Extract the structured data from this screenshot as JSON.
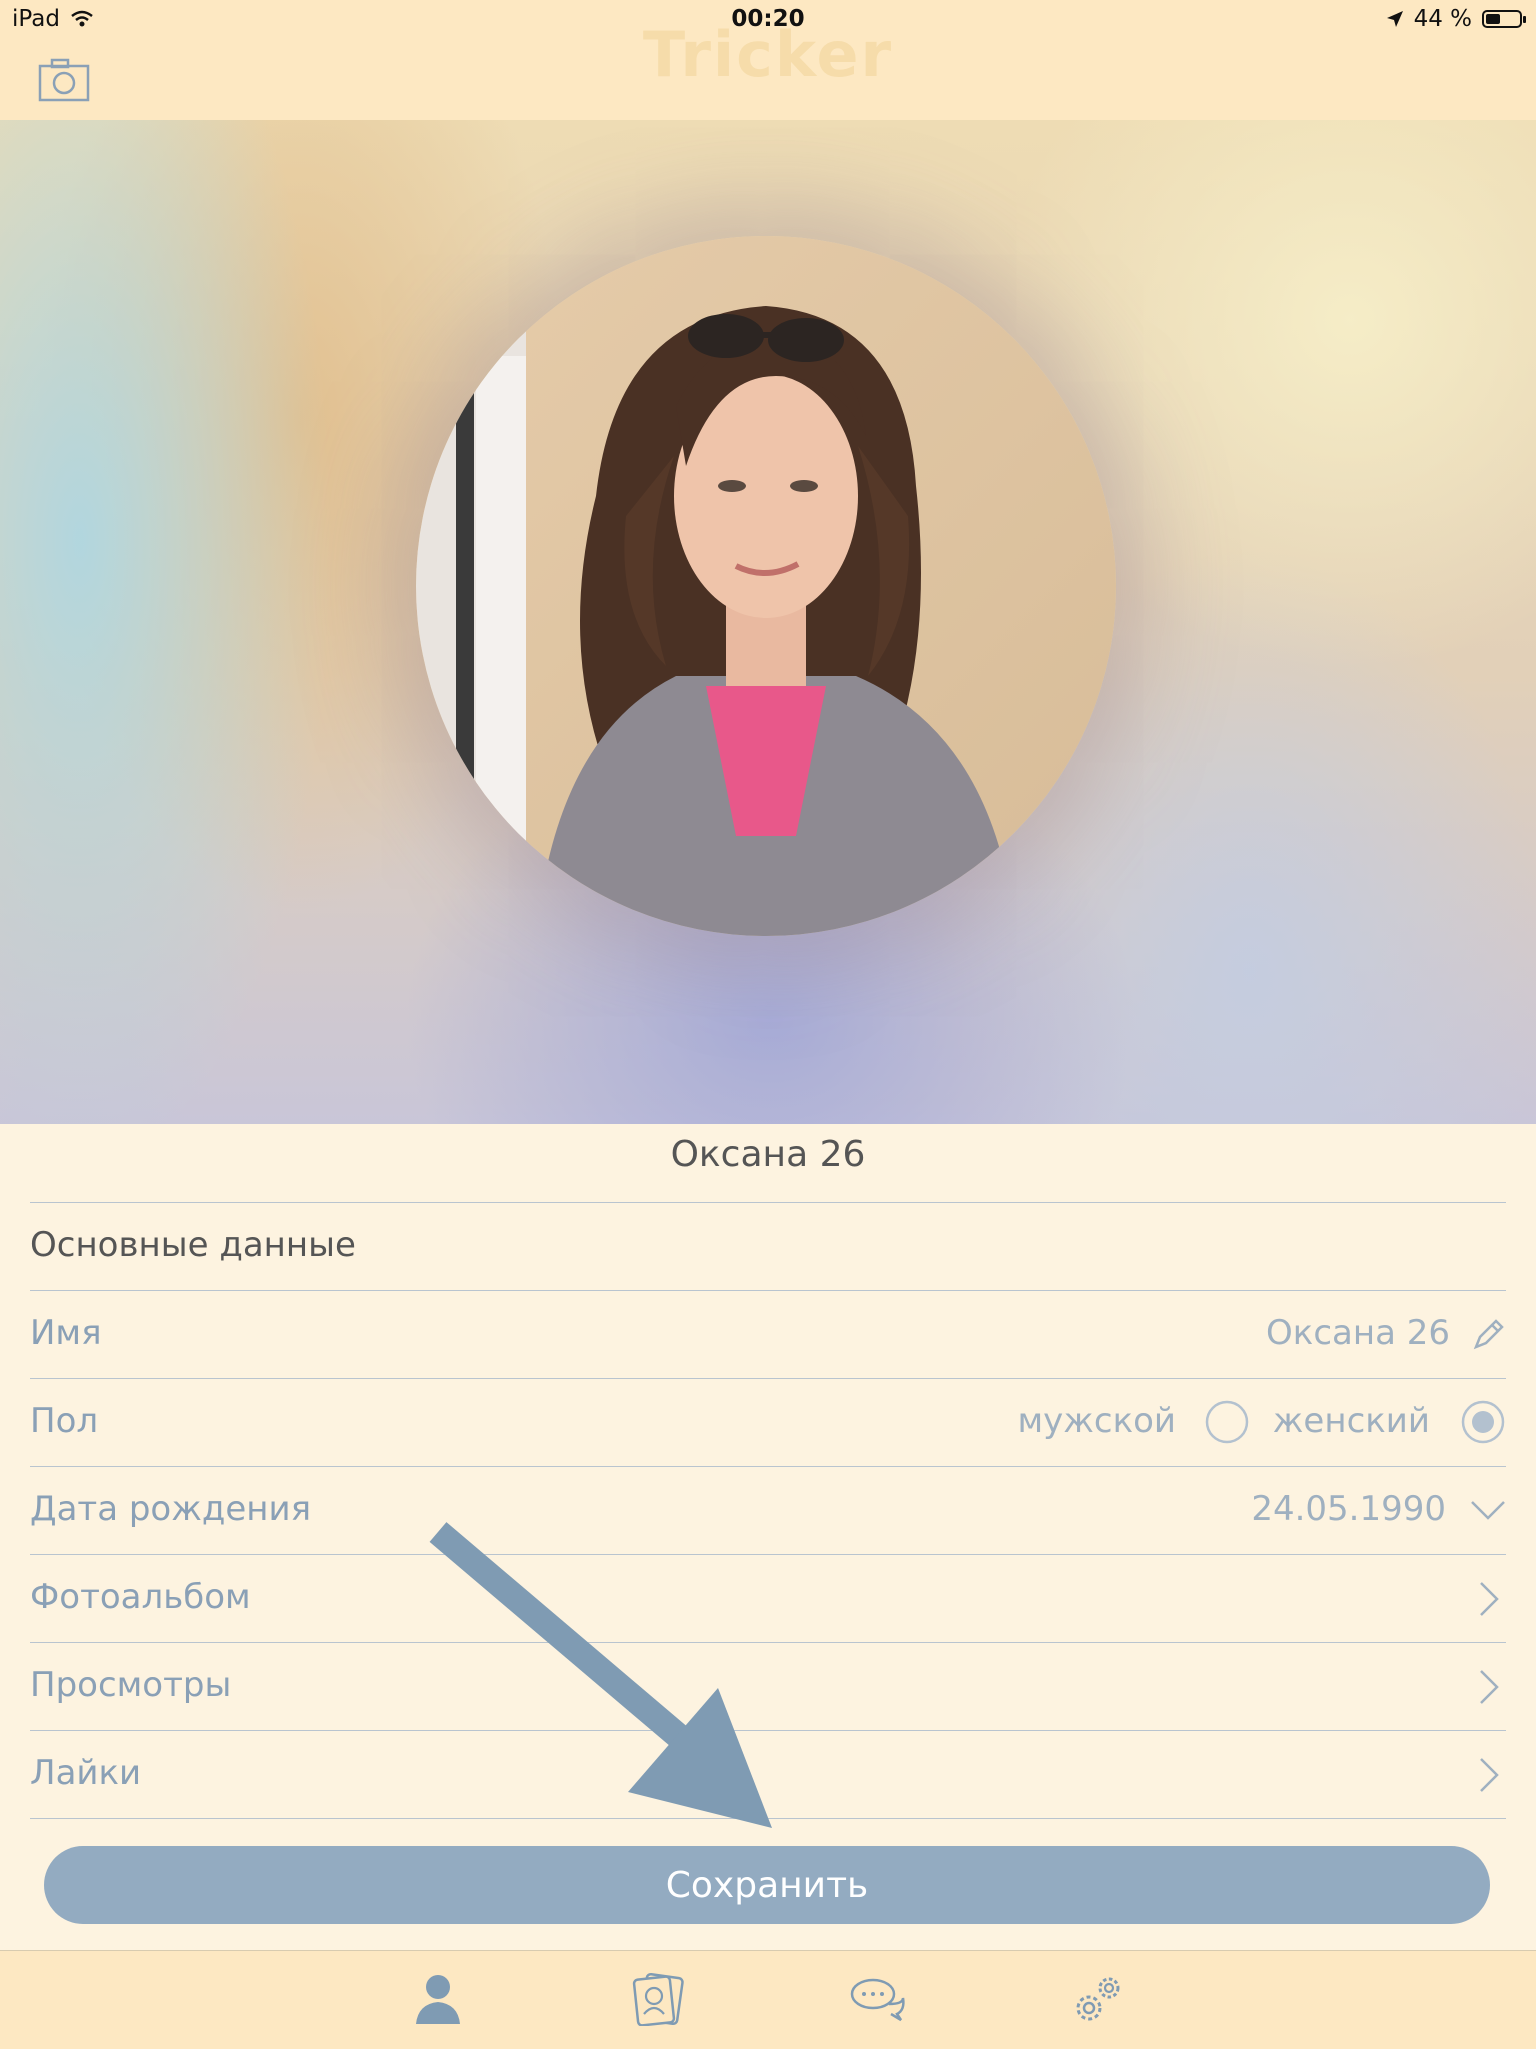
{
  "status_bar": {
    "device": "iPad",
    "time": "00:20",
    "battery": "44 %",
    "battery_level": 0.44
  },
  "header": {
    "app_title": "Tricker",
    "camera_icon": "camera-icon"
  },
  "profile": {
    "display_name": "Оксана 26",
    "section_title": "Основные данные",
    "fields": {
      "name_label": "Имя",
      "name_value": "Оксана 26",
      "gender_label": "Пол",
      "gender_male": "мужской",
      "gender_female": "женский",
      "gender_selected": "женский",
      "birth_label": "Дата рождения",
      "birth_value": "24.05.1990",
      "album_label": "Фотоальбом",
      "views_label": "Просмотры",
      "likes_label": "Лайки"
    },
    "save_label": "Сохранить"
  },
  "tabbar": {
    "items": [
      "profile-icon",
      "cards-icon",
      "chat-icon",
      "settings-icon"
    ],
    "active": "profile-icon"
  },
  "colors": {
    "accent": "#93abc1",
    "arrow": "#7f9bb3",
    "header_bg": "#fde8c2"
  }
}
